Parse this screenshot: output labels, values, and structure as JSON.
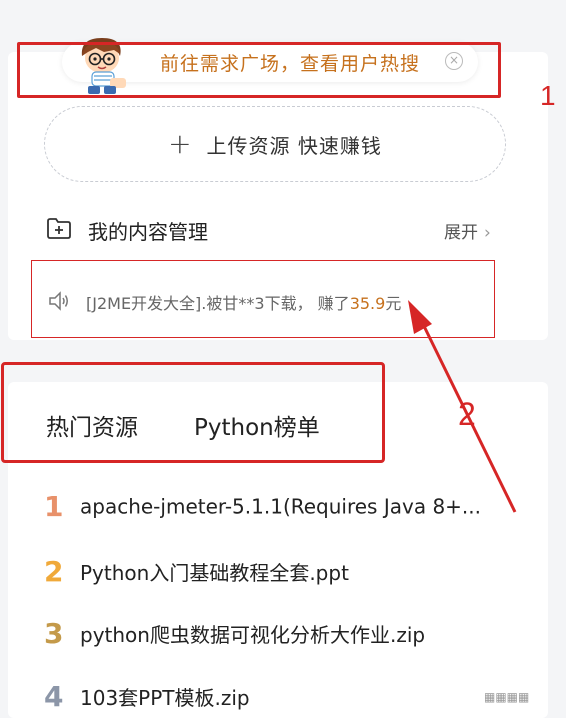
{
  "banner": {
    "text": "前往需求广场，查看用户热搜",
    "close_glyph": "×"
  },
  "annotations": {
    "label_1": "1",
    "label_2": "2"
  },
  "upload": {
    "plus": "+",
    "label": "上传资源 快速赚钱"
  },
  "content_mgmt": {
    "label": "我的内容管理",
    "expand": "展开",
    "chevron": "›"
  },
  "notice": {
    "prefix": "[J2ME开发大全].被甘**3下载，",
    "earned_label": "赚了",
    "amount": "35.9",
    "unit": "元"
  },
  "tabs": {
    "hot": "热门资源",
    "python": "Python榜单"
  },
  "hot_list": [
    {
      "rank": "1",
      "title": "apache-jmeter-5.1.1(Requires Java 8+...",
      "color": "#e8916a"
    },
    {
      "rank": "2",
      "title": "Python入门基础教程全套.ppt",
      "color": "#f0a93a"
    },
    {
      "rank": "3",
      "title": "python爬虫数据可视化分析大作业.zip",
      "color": "#c49a4a"
    },
    {
      "rank": "4",
      "title": "103套PPT模板.zip",
      "color": "#8c96a8"
    }
  ],
  "watermark": "▦▦▦▦",
  "colors": {
    "annotation": "#d62626",
    "accent": "#c6711d"
  }
}
